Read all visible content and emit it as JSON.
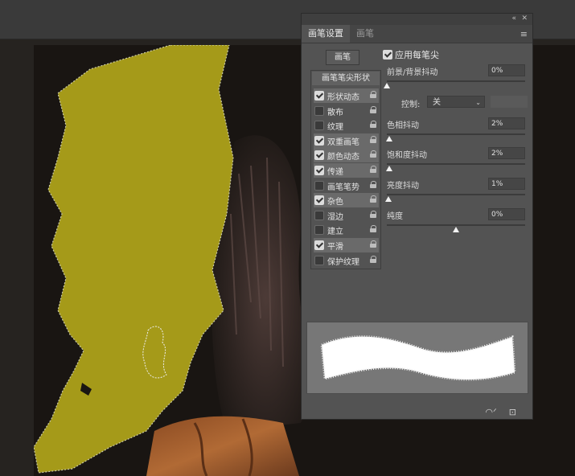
{
  "panel": {
    "tabs": [
      "画笔设置",
      "画笔"
    ],
    "preset_button": "画笔",
    "tip_shape_label": "画笔笔尖形状",
    "items": [
      {
        "label": "形状动态",
        "checked": true,
        "selected": true
      },
      {
        "label": "散布",
        "checked": false,
        "selected": false
      },
      {
        "label": "纹理",
        "checked": false,
        "selected": false
      },
      {
        "label": "双重画笔",
        "checked": true,
        "selected": true
      },
      {
        "label": "颜色动态",
        "checked": true,
        "selected": true
      },
      {
        "label": "传递",
        "checked": true,
        "selected": true
      },
      {
        "label": "画笔笔势",
        "checked": false,
        "selected": false
      },
      {
        "label": "杂色",
        "checked": true,
        "selected": true
      },
      {
        "label": "湿边",
        "checked": false,
        "selected": false
      },
      {
        "label": "建立",
        "checked": false,
        "selected": false
      },
      {
        "label": "平滑",
        "checked": true,
        "selected": true
      },
      {
        "label": "保护纹理",
        "checked": false,
        "selected": false
      }
    ],
    "apply_per_tip": {
      "label": "应用每笔尖",
      "checked": true
    },
    "params": [
      {
        "label": "前景/背景抖动",
        "value": "0%",
        "fraction": 0.0
      },
      {
        "label": "色相抖动",
        "value": "2%",
        "fraction": 0.02
      },
      {
        "label": "饱和度抖动",
        "value": "2%",
        "fraction": 0.02
      },
      {
        "label": "亮度抖动",
        "value": "1%",
        "fraction": 0.01
      },
      {
        "label": "纯度",
        "value": "0%",
        "fraction": 0.5
      }
    ],
    "control": {
      "label": "控制:",
      "value": "关"
    }
  },
  "colors": {
    "paint": "#a59a19",
    "panel_bg": "#535353",
    "preview_bg": "#777777"
  }
}
